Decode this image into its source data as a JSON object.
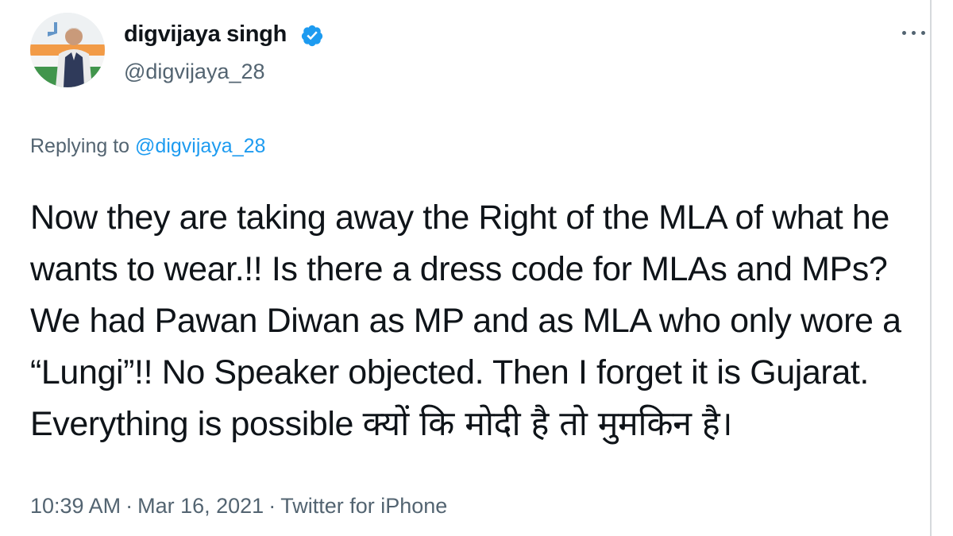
{
  "author": {
    "display_name": "digvijaya singh",
    "handle": "@digvijaya_28",
    "verified": true,
    "avatar_icon": "avatar-photo"
  },
  "reply": {
    "prefix": "Replying to",
    "target": "@digvijaya_28"
  },
  "tweet": {
    "text_en": "Now they are taking away the Right of the MLA of what he wants to wear.!! Is there a dress code for MLAs and MPs? We had Pawan Diwan as MP and as MLA who only wore a “Lungi”!! No Speaker objected. Then I forget it is Gujarat. Everything is possible ",
    "text_hi": " क्यों कि मोदी है तो मुमकिन है।"
  },
  "meta": {
    "time": "10:39 AM",
    "date": "Mar 16, 2021",
    "source": "Twitter for iPhone",
    "separator": "·"
  },
  "colors": {
    "text": "#0f1419",
    "secondary": "#536471",
    "accent": "#1d9bf0"
  },
  "icons": {
    "verified": "verified-badge-icon",
    "more": "more-options-icon"
  }
}
